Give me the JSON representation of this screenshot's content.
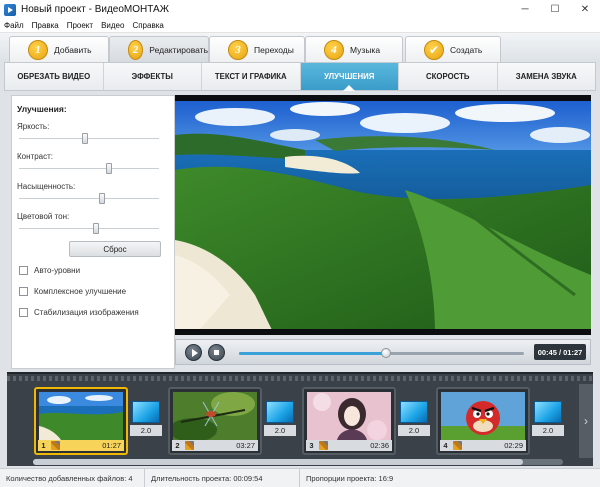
{
  "window": {
    "title": "Новый проект - ВидеоМОНТАЖ"
  },
  "menu": [
    "Файл",
    "Правка",
    "Проект",
    "Видео",
    "Справка"
  ],
  "steps": [
    {
      "num": "1",
      "label": "Добавить",
      "active": false
    },
    {
      "num": "2",
      "label": "Редактировать",
      "active": true
    },
    {
      "num": "3",
      "label": "Переходы",
      "active": false
    },
    {
      "num": "4",
      "label": "Музыка",
      "active": false
    },
    {
      "num": "✔",
      "label": "Создать",
      "active": false
    }
  ],
  "subtabs": [
    {
      "label": "ОБРЕЗАТЬ ВИДЕО",
      "active": false
    },
    {
      "label": "ЭФФЕКТЫ",
      "active": false
    },
    {
      "label": "ТЕКСТ И ГРАФИКА",
      "active": false
    },
    {
      "label": "УЛУЧШЕНИЯ",
      "active": true
    },
    {
      "label": "СКОРОСТЬ",
      "active": false
    },
    {
      "label": "ЗАМЕНА ЗВУКА",
      "active": false
    }
  ],
  "enhance": {
    "title": "Улучшения:",
    "sliders": [
      {
        "label": "Яркость:",
        "value": 0.47
      },
      {
        "label": "Контраст:",
        "value": 0.65
      },
      {
        "label": "Насыщенность:",
        "value": 0.6
      },
      {
        "label": "Цветовой тон:",
        "value": 0.55
      }
    ],
    "reset_label": "Сброс",
    "checkboxes": [
      {
        "label": "Авто-уровни",
        "checked": false
      },
      {
        "label": "Комплексное улучшение",
        "checked": false
      },
      {
        "label": "Стабилизация изображения",
        "checked": false
      }
    ]
  },
  "player": {
    "time": "00:45 / 01:27",
    "progress": 0.517
  },
  "timeline": {
    "clips": [
      {
        "num": "1",
        "duration": "01:27",
        "selected": true,
        "scene": "coast"
      },
      {
        "num": "2",
        "duration": "03:27",
        "selected": false,
        "scene": "dragonfly"
      },
      {
        "num": "3",
        "duration": "02:36",
        "selected": false,
        "scene": "anime"
      },
      {
        "num": "4",
        "duration": "02:29",
        "selected": false,
        "scene": "angry-bird"
      }
    ],
    "transitions": [
      "2.0",
      "2.0",
      "2.0",
      "2.0"
    ]
  },
  "status": {
    "files": "Количество добавленных файлов: 4",
    "length": "Длительность проекта:  00:09:54",
    "ratio": "Пропорции проекта:  16:9"
  },
  "colors": {
    "accent": "#3a9cc9",
    "step_badge": "#f0b020",
    "selected_clip": "#f0b800"
  }
}
